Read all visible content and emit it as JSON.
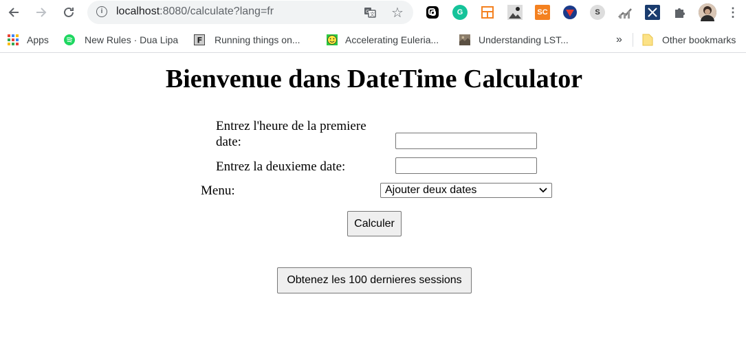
{
  "browser": {
    "url_host": "localhost",
    "url_rest": ":8080/calculate?lang=fr",
    "bookmarks": [
      {
        "label": "Apps",
        "icon": "apps-grid-icon"
      },
      {
        "label": "New Rules · Dua Lipa",
        "icon": "spotify-icon"
      },
      {
        "label": "Running things on...",
        "icon": "f-letter-icon"
      },
      {
        "label": "Accelerating Euleria...",
        "icon": "smiley-icon"
      },
      {
        "label": "Understanding LST...",
        "icon": "image-thumb-icon"
      }
    ],
    "bookmarks_overflow": "»",
    "other_bookmarks": "Other bookmarks",
    "extensions": [
      "chain-icon",
      "grammarly-icon",
      "layout-icon",
      "photo-icon",
      "sc-icon",
      "superhero-icon",
      "s-icon",
      "chart-icon",
      "x-icon",
      "puzzle-icon",
      "profile-avatar-icon",
      "menu-dots-icon"
    ],
    "ext_sc_text": "SC",
    "ext_s_text": "S",
    "ext_g_text": "G"
  },
  "page": {
    "title": "Bienvenue dans DateTime Calculator",
    "first_date_label_line1": "Entrez l'heure de la premiere",
    "first_date_label_line2": "date:",
    "first_date_value": "",
    "second_date_label": "Entrez la deuxieme date:",
    "second_date_value": "",
    "menu_label": "Menu:",
    "menu_selected": "Ajouter deux dates",
    "calculate_button": "Calculer",
    "sessions_button": "Obtenez les 100 dernieres sessions"
  },
  "colors": {
    "spotify": "#1ed760",
    "grammarly": "#15c39a",
    "sc_orange": "#f48120",
    "smiley_bg": "#2ecc40"
  }
}
